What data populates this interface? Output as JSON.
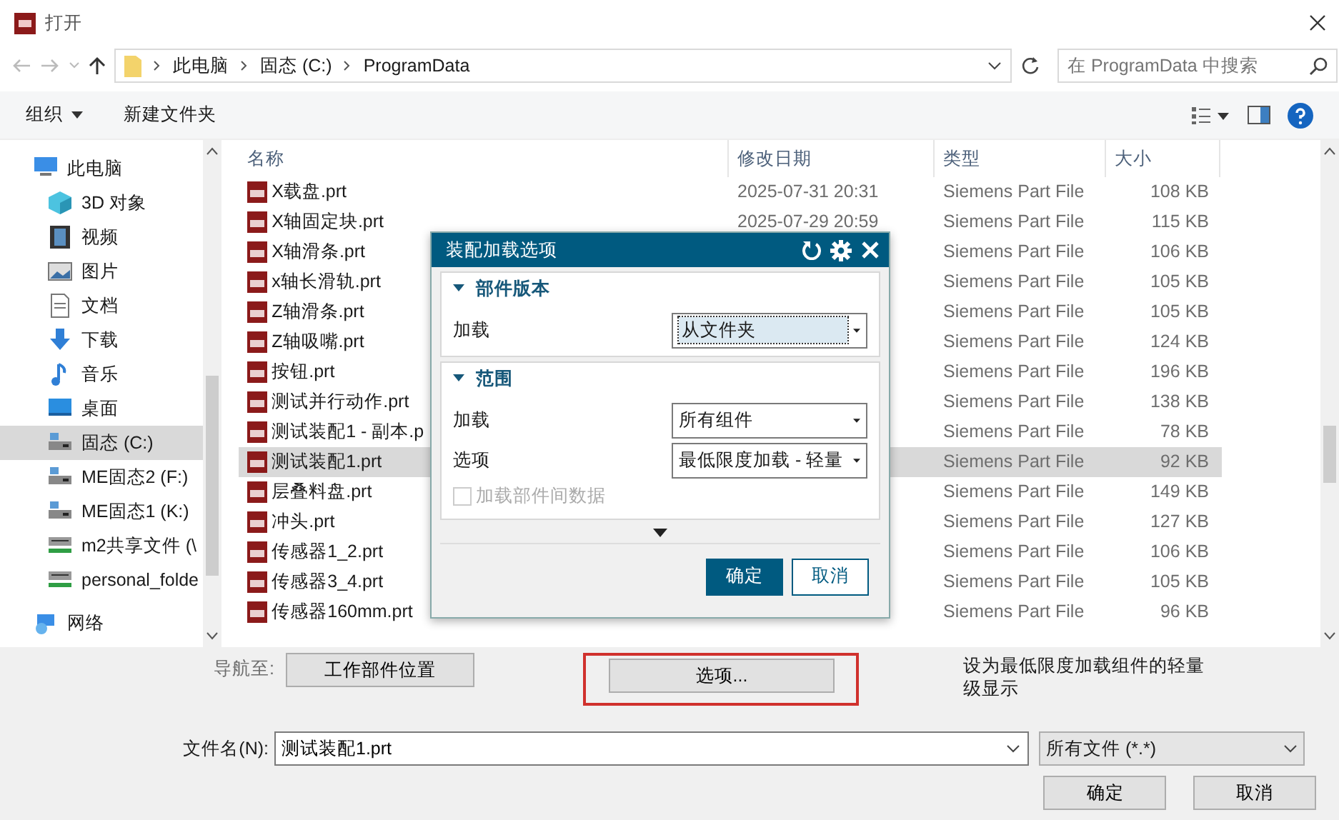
{
  "window": {
    "title": "打开"
  },
  "address": {
    "crumbs": [
      "此电脑",
      "固态 (C:)",
      "ProgramData"
    ],
    "search_placeholder": "在 ProgramData 中搜索"
  },
  "toolbar": {
    "organize": "组织",
    "new_folder": "新建文件夹"
  },
  "sidebar": {
    "items": [
      {
        "label": "此电脑",
        "kind": "computer",
        "selected": false,
        "children": [
          {
            "label": "3D 对象",
            "kind": "cube",
            "selected": false
          },
          {
            "label": "视频",
            "kind": "film",
            "selected": false
          },
          {
            "label": "图片",
            "kind": "image",
            "selected": false
          },
          {
            "label": "文档",
            "kind": "document",
            "selected": false
          },
          {
            "label": "下载",
            "kind": "download",
            "selected": false
          },
          {
            "label": "音乐",
            "kind": "music",
            "selected": false
          },
          {
            "label": "桌面",
            "kind": "desktop",
            "selected": false
          },
          {
            "label": "固态 (C:)",
            "kind": "drive",
            "selected": true
          },
          {
            "label": "ME固态2 (F:)",
            "kind": "drive",
            "selected": false
          },
          {
            "label": "ME固态1 (K:)",
            "kind": "drive",
            "selected": false
          },
          {
            "label": "m2共享文件 (\\",
            "kind": "netdrive",
            "selected": false
          },
          {
            "label": "personal_folde",
            "kind": "netdrive",
            "selected": false
          }
        ]
      },
      {
        "label": "网络",
        "kind": "network",
        "selected": false
      }
    ]
  },
  "table": {
    "columns": [
      "名称",
      "修改日期",
      "类型",
      "大小"
    ],
    "rows": [
      {
        "name": "X载盘.prt",
        "date": "2025-07-31 20:31",
        "type": "Siemens Part File",
        "size": "108 KB",
        "selected": false
      },
      {
        "name": "X轴固定块.prt",
        "date": "2025-07-29 20:59",
        "type": "Siemens Part File",
        "size": "115 KB",
        "selected": false
      },
      {
        "name": "X轴滑条.prt",
        "type": "Siemens Part File",
        "size": "106 KB",
        "selected": false
      },
      {
        "name": "x轴长滑轨.prt",
        "type": "Siemens Part File",
        "size": "105 KB",
        "selected": false
      },
      {
        "name": "Z轴滑条.prt",
        "type": "Siemens Part File",
        "size": "105 KB",
        "selected": false
      },
      {
        "name": "Z轴吸嘴.prt",
        "type": "Siemens Part File",
        "size": "124 KB",
        "selected": false
      },
      {
        "name": "按钮.prt",
        "type": "Siemens Part File",
        "size": "196 KB",
        "selected": false
      },
      {
        "name": "测试并行动作.prt",
        "type": "Siemens Part File",
        "size": "138 KB",
        "selected": false
      },
      {
        "name": "测试装配1 - 副本.p",
        "type": "Siemens Part File",
        "size": "78 KB",
        "selected": false
      },
      {
        "name": "测试装配1.prt",
        "type": "Siemens Part File",
        "size": "92 KB",
        "selected": true
      },
      {
        "name": "层叠料盘.prt",
        "type": "Siemens Part File",
        "size": "149 KB",
        "selected": false
      },
      {
        "name": "冲头.prt",
        "type": "Siemens Part File",
        "size": "127 KB",
        "selected": false
      },
      {
        "name": "传感器1_2.prt",
        "type": "Siemens Part File",
        "size": "106 KB",
        "selected": false
      },
      {
        "name": "传感器3_4.prt",
        "type": "Siemens Part File",
        "size": "105 KB",
        "selected": false
      },
      {
        "name": "传感器160mm.prt",
        "type": "Siemens Part File",
        "size": "96 KB",
        "selected": false
      }
    ]
  },
  "dialog": {
    "title": "装配加载选项",
    "sections": [
      {
        "title": "部件版本",
        "expanded": true,
        "fields": [
          {
            "label": "加载",
            "value": "从文件夹",
            "focused": true
          }
        ]
      },
      {
        "title": "范围",
        "expanded": true,
        "fields": [
          {
            "label": "加载",
            "value": "所有组件",
            "focused": false
          },
          {
            "label": "选项",
            "value": "最低限度加载 - 轻量",
            "focused": false
          }
        ],
        "checkbox": {
          "label": "加载部件间数据",
          "checked": false,
          "disabled": true
        }
      }
    ],
    "ok": "确定",
    "cancel": "取消"
  },
  "bottom": {
    "navigate_label": "导航至:",
    "work_part_button": "工作部件位置",
    "options_button": "选项...",
    "options_highlighted": true,
    "hint": "设为最低限度加载组件的轻量级显示",
    "filename_label": "文件名(N):",
    "filename": "测试装配1.prt",
    "filter": "所有文件 (*.*)",
    "ok": "确定",
    "cancel": "取消"
  }
}
